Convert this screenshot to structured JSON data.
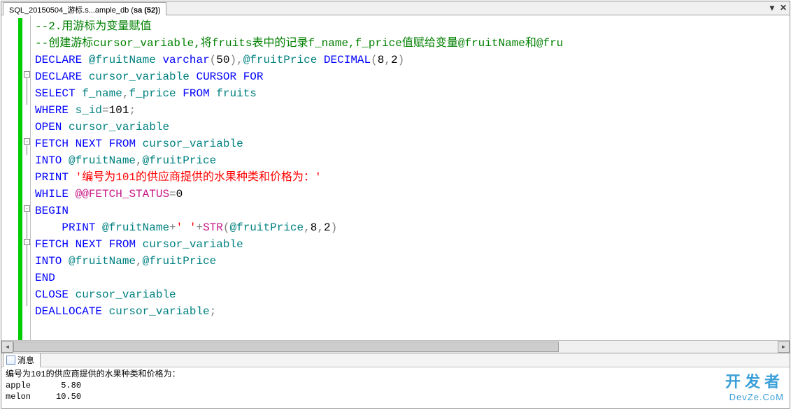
{
  "tab": {
    "label_prefix": "SQL_20150504_游标.s...ample_db (",
    "label_bold": "sa (52)",
    "label_suffix": ")"
  },
  "controls": {
    "drop": "▾",
    "close": "✕"
  },
  "code": {
    "l1_a": "--2.用游标为变量赋值",
    "l2_a": "--创建游标cursor_variable,将fruits表中的记录f_name,f_price值赋给变量@fruitName和@fru",
    "l3": {
      "kw1": "DECLARE",
      "v1": "@fruitName",
      "ty1": "varchar",
      "p1": "(",
      "n1": "50",
      "p2": "),",
      "v2": "@fruitPrice",
      "ty2": "DECIMAL",
      "p3": "(",
      "n2": "8",
      "p4": ",",
      "n3": "2",
      "p5": ")"
    },
    "l4": {
      "kw1": "DECLARE",
      "id": "cursor_variable",
      "kw2": "CURSOR",
      "kw3": "FOR"
    },
    "l5": {
      "kw1": "SELECT",
      "c1": "f_name",
      "p1": ",",
      "c2": "f_price",
      "kw2": "FROM",
      "t": "fruits"
    },
    "l6": {
      "kw1": "WHERE",
      "c1": "s_id",
      "op": "=",
      "n": "101",
      "p": ";"
    },
    "l7": {
      "kw1": "OPEN",
      "id": "cursor_variable"
    },
    "l8": {
      "kw1": "FETCH",
      "kw2": "NEXT",
      "kw3": "FROM",
      "id": "cursor_variable"
    },
    "l9": {
      "kw1": "INTO",
      "v1": "@fruitName",
      "p1": ",",
      "v2": "@fruitPrice"
    },
    "l10": {
      "kw1": "PRINT",
      "str": "'编号为101的供应商提供的水果种类和价格为：'"
    },
    "l11": {
      "kw1": "WHILE",
      "sv": "@@FETCH_STATUS",
      "op": "=",
      "n": "0"
    },
    "l12": {
      "kw1": "BEGIN"
    },
    "l13": {
      "kw1": "PRINT",
      "v1": "@fruitName",
      "op1": "+",
      "s1": "' '",
      "op2": "+",
      "fn": "STR",
      "p1": "(",
      "v2": "@fruitPrice",
      "p2": ",",
      "n1": "8",
      "p3": ",",
      "n2": "2",
      "p4": ")"
    },
    "l14": {
      "kw1": "FETCH",
      "kw2": "NEXT",
      "kw3": "FROM",
      "id": "cursor_variable"
    },
    "l15": {
      "kw1": "INTO",
      "v1": "@fruitName",
      "p1": ",",
      "v2": "@fruitPrice"
    },
    "l16": {
      "kw1": "END"
    },
    "l17": {
      "kw1": "CLOSE",
      "id": "cursor_variable"
    },
    "l18": {
      "kw1": "DEALLOCATE",
      "id": "cursor_variable",
      "p": ";"
    }
  },
  "messages": {
    "tab_label": "消息",
    "line1": "编号为101的供应商提供的水果种类和价格为：",
    "line2": "apple      5.80",
    "line3": "melon     10.50"
  },
  "watermark": {
    "cn": "开发者",
    "en": "DevZe.CoM"
  }
}
